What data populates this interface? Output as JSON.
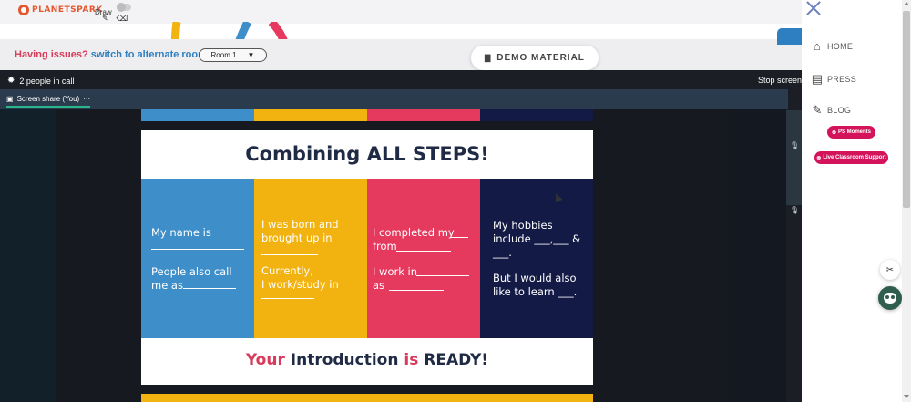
{
  "topbar": {
    "logo_text": "PLANETSPARK",
    "draw_label": "Draw",
    "pencil_icon": "✎",
    "eraser_icon": "⌫"
  },
  "issues": {
    "prefix": "Having issues?",
    "link": "switch to alternate room",
    "room": "Room 1",
    "room_arrow": "▼"
  },
  "demo": {
    "folder_icon": "▇",
    "label": "DEMO MATERIAL"
  },
  "call": {
    "gear_icon": "✹",
    "people": "2 people in call",
    "stop_screen": "Stop screen",
    "share_icon": "▣",
    "share_tab": "Screen share (You)",
    "more": "···",
    "mic_icon": "🎙"
  },
  "slide": {
    "title": "Combining ALL STEPS!",
    "colors": [
      "#3d8ec9",
      "#f2b20f",
      "#e53a5e",
      "#121a45"
    ],
    "col1_a": "My name is",
    "col1_b": "People also call\nme as",
    "col2_a": "I was born and\nbrought up in",
    "col2_b": "Currently,\nI work/study in",
    "col3_a": "I completed my\nfrom",
    "col3_b": "I work in\nas",
    "col4_a": "My hobbies\ninclude ___,___ &\n___.",
    "col4_b": "But I would also\nlike to learn ___.",
    "footer_1": "Your",
    "footer_2": " Introduction ",
    "footer_3": "is",
    "footer_4": " READY!"
  },
  "sidebar": {
    "home_icon": "⌂",
    "home": "HOME",
    "press_icon": "▤",
    "press": "PRESS",
    "blog_icon": "✎",
    "blog": "BLOG",
    "ps_moments": "PS Moments",
    "live_support": "Live Classroom Support",
    "pill_icon": "⊗",
    "tools_icon": "✂"
  }
}
